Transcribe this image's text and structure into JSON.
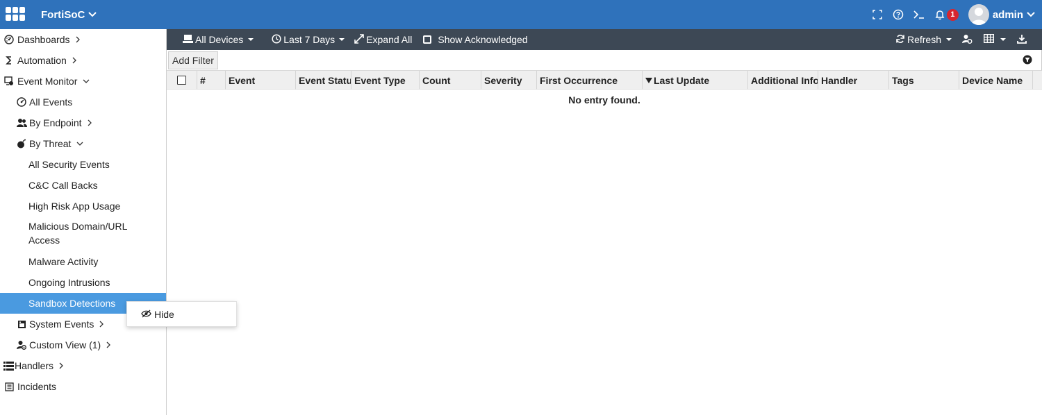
{
  "header": {
    "app_name": "FortiSoC",
    "notification_count": "1",
    "username": "admin"
  },
  "sidebar": {
    "items": [
      {
        "label": "Dashboards",
        "icon": "dashboard-icon"
      },
      {
        "label": "Automation",
        "icon": "automation-icon"
      },
      {
        "label": "Event Monitor",
        "icon": "event-monitor-icon"
      },
      {
        "label": "All Events",
        "icon": "dashboard-icon"
      },
      {
        "label": "By Endpoint",
        "icon": "users-icon"
      },
      {
        "label": "By Threat",
        "icon": "bomb-icon"
      },
      {
        "label": "All Security Events"
      },
      {
        "label": "C&C Call Backs"
      },
      {
        "label": "High Risk App Usage"
      },
      {
        "label": "Malicious Domain/URL Access"
      },
      {
        "label": "Malware Activity"
      },
      {
        "label": "Ongoing Intrusions"
      },
      {
        "label": "Sandbox Detections"
      },
      {
        "label": "System Events",
        "icon": "system-events-icon"
      },
      {
        "label": "Custom View (1)",
        "icon": "custom-view-icon"
      },
      {
        "label": "Handlers",
        "icon": "list-icon"
      },
      {
        "label": "Incidents",
        "icon": "incidents-icon"
      }
    ]
  },
  "context_menu": {
    "hide_label": "Hide"
  },
  "toolbar": {
    "devices_label": "All Devices",
    "time_label": "Last 7 Days",
    "expand_label": "Expand All",
    "show_ack_label": "Show Acknowledged",
    "refresh_label": "Refresh"
  },
  "filter": {
    "add_filter_label": "Add Filter"
  },
  "table": {
    "columns": [
      "#",
      "Event",
      "Event Status",
      "Event Type",
      "Count",
      "Severity",
      "First Occurrence",
      "Last Update",
      "Additional Info",
      "Handler",
      "Tags",
      "Device Name"
    ],
    "empty_message": "No entry found."
  },
  "colors": {
    "header_bg": "#2f72bb",
    "toolbar_bg": "#3d4855",
    "active_item": "#4a9ae0",
    "badge": "#d8262f"
  }
}
